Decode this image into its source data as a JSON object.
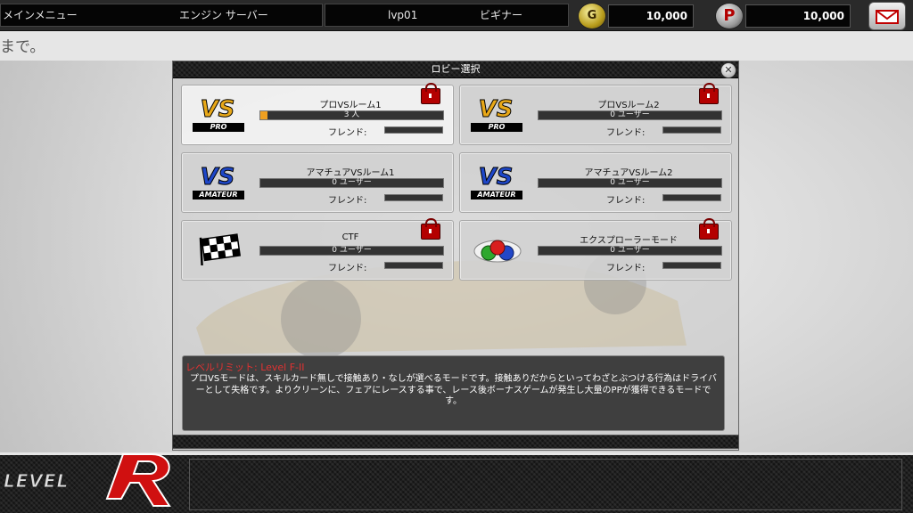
{
  "topbar": {
    "main_menu": "メインメニュー",
    "server": "エンジン サーバー",
    "level": "lvp01",
    "rank": "ビギナー",
    "gold_value": "10,000",
    "pp_value": "10,000",
    "gold_icon": "coin-icon",
    "pp_icon": "pp-coin-icon",
    "mail_icon": "mail-icon"
  },
  "marquee": {
    "text": "まで。"
  },
  "lobby": {
    "title": "ロビー選択",
    "close_icon": "close-icon",
    "rooms": [
      {
        "name": "プロVSルーム1",
        "count": "3 人",
        "friend_label": "フレンド:",
        "locked": true,
        "logo": "vs-pro-logo",
        "logo_text": "VS",
        "logo_sub": "PRO",
        "fill_percent": 4
      },
      {
        "name": "プロVSルーム2",
        "count": "0 ユーザー",
        "friend_label": "フレンド:",
        "locked": true,
        "logo": "vs-pro-logo",
        "logo_text": "VS",
        "logo_sub": "PRO",
        "fill_percent": 0
      },
      {
        "name": "アマチュアVSルーム1",
        "count": "0 ユーザー",
        "friend_label": "フレンド:",
        "locked": false,
        "logo": "vs-amateur-logo",
        "logo_text": "VS",
        "logo_sub": "AMATEUR",
        "fill_percent": 0
      },
      {
        "name": "アマチュアVSルーム2",
        "count": "0 ユーザー",
        "friend_label": "フレンド:",
        "locked": false,
        "logo": "vs-amateur-logo",
        "logo_text": "VS",
        "logo_sub": "AMATEUR",
        "fill_percent": 0
      },
      {
        "name": "CTF",
        "count": "0 ユーザー",
        "friend_label": "フレンド:",
        "locked": true,
        "logo": "checkered-flag-icon",
        "fill_percent": 0
      },
      {
        "name": "エクスプローラーモード",
        "count": "0 ユーザー",
        "friend_label": "フレンド:",
        "locked": true,
        "logo": "color-orbs-icon",
        "fill_percent": 0
      }
    ],
    "description": {
      "level_limit": "レベルリミット: Level F-II",
      "text": "プロVSモードは、スキルカード無しで接触あり・なしが選べるモードです。接触ありだからといってわざとぶつける行為はドライバーとして失格です。よりクリーンに、フェアにレースする事で、レース後ボーナスゲームが発生し大量のPPが獲得できるモードです。"
    }
  },
  "brand": {
    "logo": "level-r-logo",
    "text": "LEVEL"
  }
}
